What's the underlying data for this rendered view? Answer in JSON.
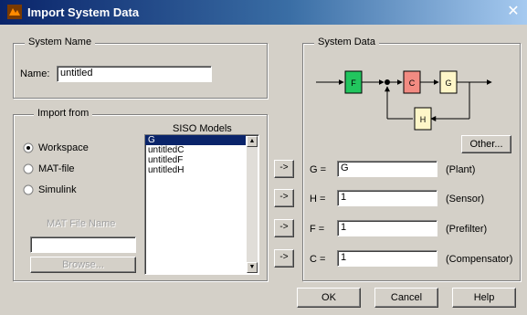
{
  "window": {
    "title": "Import System Data",
    "close_glyph": "✕"
  },
  "system_name": {
    "legend": "System Name",
    "name_label": "Name:",
    "name_value": "untitled"
  },
  "import_from": {
    "legend": "Import from",
    "options": [
      {
        "label": "Workspace",
        "checked": true
      },
      {
        "label": "MAT-file",
        "checked": false
      },
      {
        "label": "Simulink",
        "checked": false
      }
    ],
    "mat_file_label": "MAT File Name",
    "mat_file_value": "",
    "browse_label": "Browse..."
  },
  "siso_models": {
    "title": "SISO Models",
    "items": [
      "G",
      "untitledC",
      "untitledF",
      "untitledH"
    ],
    "selected_index": 0
  },
  "system_data": {
    "legend": "System Data",
    "blocks": {
      "F": "F",
      "C": "C",
      "G": "G",
      "H": "H"
    },
    "other_button": "Other...",
    "rows": [
      {
        "arrow": "->",
        "label": "G =",
        "value": "G",
        "desc": "(Plant)"
      },
      {
        "arrow": "->",
        "label": "H =",
        "value": "1",
        "desc": "(Sensor)"
      },
      {
        "arrow": "->",
        "label": "F =",
        "value": "1",
        "desc": "(Prefilter)"
      },
      {
        "arrow": "->",
        "label": "C =",
        "value": "1",
        "desc": "(Compensator)"
      }
    ]
  },
  "buttons": {
    "ok": "OK",
    "cancel": "Cancel",
    "help": "Help"
  }
}
